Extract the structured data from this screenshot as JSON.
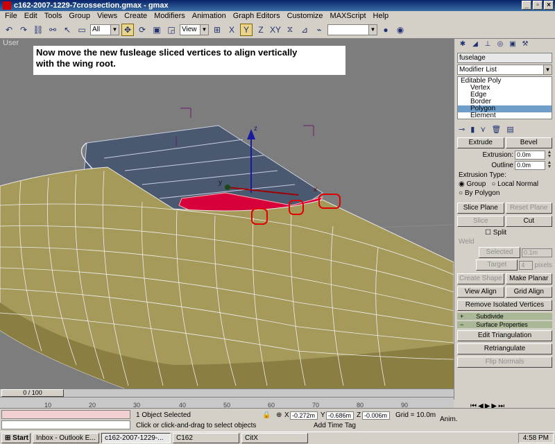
{
  "window": {
    "title": "c162-2007-1229-7crossection.gmax - gmax"
  },
  "menu": [
    "File",
    "Edit",
    "Tools",
    "Group",
    "Views",
    "Create",
    "Modifiers",
    "Animation",
    "Graph Editors",
    "Customize",
    "MAXScript",
    "Help"
  ],
  "toolbar": {
    "selection_filter": "All",
    "ref_coord": "View",
    "axes": [
      "X",
      "Y",
      "Z",
      "XY"
    ]
  },
  "viewport": {
    "label": "User",
    "note_line1": "Now move the new fusleage sliced vertices to align vertically",
    "note_line2": "with the wing root.",
    "gizmo_labels": {
      "x": "x",
      "y": "y",
      "z": "z"
    },
    "colors": {
      "background": "#7d7d7d",
      "fuselage": "#a69a5a",
      "wing": "#4a5870",
      "selected_poly": "#d8003a",
      "highlight_circle": "#e00000"
    }
  },
  "command_panel": {
    "object_name": "fuselage",
    "modifier_list": "Modifier List",
    "stack": [
      {
        "label": "Editable Poly"
      },
      {
        "label": "Vertex"
      },
      {
        "label": "Edge"
      },
      {
        "label": "Border"
      },
      {
        "label": "Polygon"
      },
      {
        "label": "Element"
      }
    ],
    "extrude": "Extrude",
    "bevel": "Bevel",
    "extrusion_label": "Extrusion:",
    "extrusion_value": "0.0m",
    "outline_label": "Outline",
    "outline_value": "0.0m",
    "extrusion_type_label": "Extrusion Type:",
    "type_group": "Group",
    "type_local": "Local Normal",
    "type_polygon": "By Polygon",
    "slice_plane": "Slice Plane",
    "reset_plane": "Reset Plane",
    "slice": "Slice",
    "cut": "Cut",
    "split": "Split",
    "weld_label": "Weld",
    "selected": "Selected",
    "selected_value": "0.1m",
    "target": "Target",
    "target_value": "4",
    "pixels": "pixels",
    "create_shape": "Create Shape",
    "make_planar": "Make Planar",
    "view_align": "View Align",
    "grid_align": "Grid Align",
    "remove_isolated": "Remove Isolated Vertices",
    "subdivide": "Subdivide",
    "surface_properties": "Surface Properties",
    "edit_triangulation": "Edit Triangulation",
    "retriangulate": "Retriangulate",
    "flip_normals": "Flip Normals"
  },
  "timeline": {
    "slider": "0 / 100",
    "ticks": [
      "10",
      "20",
      "30",
      "40",
      "50",
      "60",
      "70",
      "80",
      "90"
    ]
  },
  "status": {
    "objects_selected": "1 Object Selected",
    "prompt": "Click or click-and-drag to select objects",
    "x_label": "X",
    "x": "-0.272m",
    "y_label": "Y",
    "y": "-0.686m",
    "z_label": "Z",
    "z": "-0.006m",
    "grid": "Grid = 10.0m",
    "add_time_tag": "Add Time Tag",
    "anim": "Anim.",
    "frame": "0"
  },
  "taskbar": {
    "start": "Start",
    "tasks": [
      "Inbox - Outlook E...",
      "c162-2007-1229-...",
      "C162",
      "CitX"
    ],
    "clock": "4:58 PM"
  }
}
